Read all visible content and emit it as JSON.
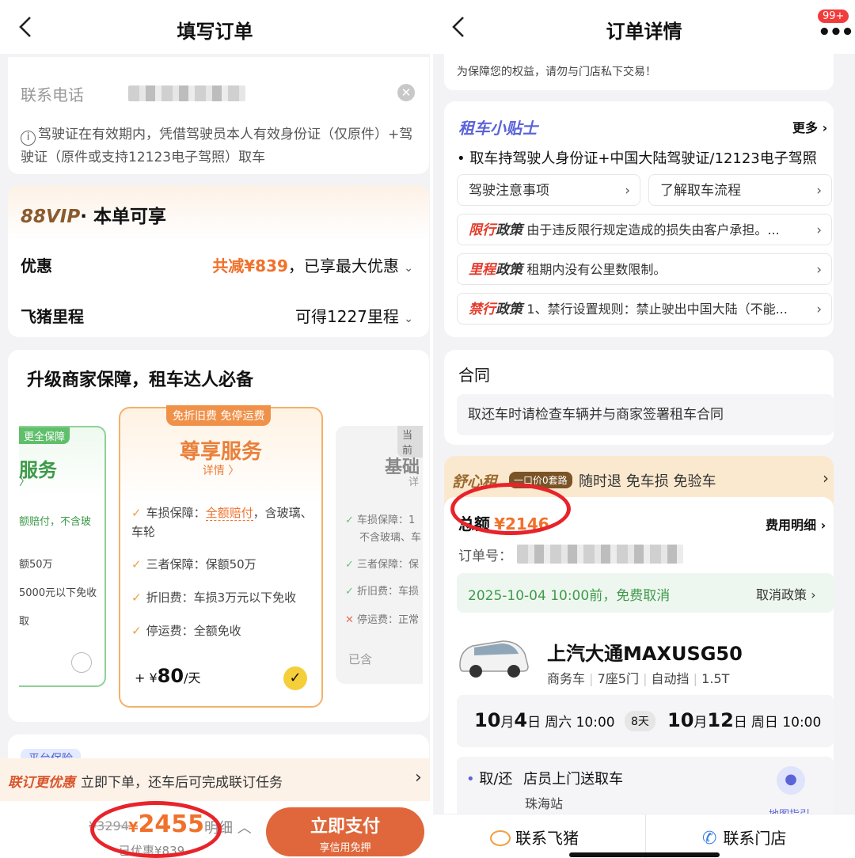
{
  "left": {
    "title": "填写订单",
    "contact_label": "联系电话",
    "license_note": "驾驶证在有效期内，凭借驾驶员本人有效身份证（仅原件）+驾驶证（原件或支持12123电子驾照）取车",
    "vip_title": "88VIP",
    "vip_suffix": "· 本单可享",
    "discount_label": "优惠",
    "discount_value": "共减¥839",
    "discount_note": "，已享最大优惠",
    "mileage_label": "飞猪里程",
    "mileage_value": "可得1227里程",
    "upgrade_title": "升级商家保障，租车达人必备",
    "plan_left": {
      "badge": "更全保障",
      "name": "服务",
      "items": [
        "额赔付，不含玻",
        "额50万",
        "5000元以下免收",
        "取"
      ]
    },
    "plan_mid": {
      "badge": "免折旧费 免停运费",
      "name": "尊享服务",
      "detail": "详情",
      "items": [
        {
          "label": "车损保障：",
          "hl": "全额赔付",
          "rest": "，含玻璃、车轮"
        },
        {
          "label": "三者保障：",
          "hl": "保额50万",
          "rest": ""
        },
        {
          "label": "折旧费：",
          "hl": "车损3万元以下免收",
          "rest": ""
        },
        {
          "label": "停运费：",
          "hl": "全额免收",
          "rest": ""
        }
      ],
      "price_prefix": "+ ¥",
      "price": "80",
      "unit": "/天"
    },
    "plan_right": {
      "badge": "当前",
      "name": "基础",
      "detail": "详",
      "items": [
        "车损保障：1",
        "不含玻璃、车",
        "三者保障：保",
        "折旧费：车损",
        "停运费：正常"
      ],
      "status": "已含"
    },
    "platform_tag": "平台保险",
    "promo_tag": "联订更优惠",
    "promo_text": "立即下单，还车后可完成联订任务",
    "orig_price": "¥3294",
    "price_symbol": "¥",
    "price": "2455",
    "price_detail": "明细",
    "saved": "已优惠¥839",
    "pay_button": "立即支付",
    "pay_sub": "享信用免押"
  },
  "right": {
    "title": "订单详情",
    "badge": "99+",
    "warning": "为保障您的权益，请勿与门店私下交易！",
    "tips_title": "租车小贴士",
    "more": "更多",
    "tip_bullet": "取车持驾驶人身份证+中国大陆驾驶证/12123电子驾照",
    "link1": "驾驶注意事项",
    "link2": "了解取车流程",
    "policies": [
      {
        "red": "限行",
        "black": "政策",
        "text": "由于违反限行规定造成的损失由客户承担。..."
      },
      {
        "red": "里程",
        "black": "政策",
        "text": "租期内没有公里数限制。"
      },
      {
        "red": "禁行",
        "black": "政策",
        "text": "1、禁行设置规则：禁止驶出中国大陆（不能..."
      }
    ],
    "contract_title": "合同",
    "contract_text": "取还车时请检查车辆并与商家签署租车合同",
    "shuxin": "舒心租",
    "shuxin_tag": "一口价0套路",
    "shuxin_text": "随时退 免车损 免验车",
    "total_label": "总额",
    "total_value": "¥2146",
    "fee_detail": "费用明细",
    "order_label": "订单号：",
    "cancel_note": "2025-10-04 10:00前，免费取消",
    "cancel_policy": "取消政策",
    "car_name": "上汽大通MAXUSG50",
    "car_specs": [
      "商务车",
      "7座5门",
      "自动挡",
      "1.5T"
    ],
    "pickup_month": "10",
    "pickup_day": "4",
    "pickup_week": "周六 10:00",
    "days": "8天",
    "return_month": "10",
    "return_day": "12",
    "return_week": "周日 10:00",
    "month_char": "月",
    "day_char": "日",
    "pickup_mode_label": "取/还",
    "pickup_mode": "店员上门送取车",
    "station": "珠海站",
    "map_label": "地图指引",
    "contact_fliggy": "联系飞猪",
    "contact_store": "联系门店"
  },
  "colors": {
    "accent": "#f0712b",
    "pay": "#e0673b",
    "green": "#5fbf6a",
    "circle": "#e8232a"
  }
}
